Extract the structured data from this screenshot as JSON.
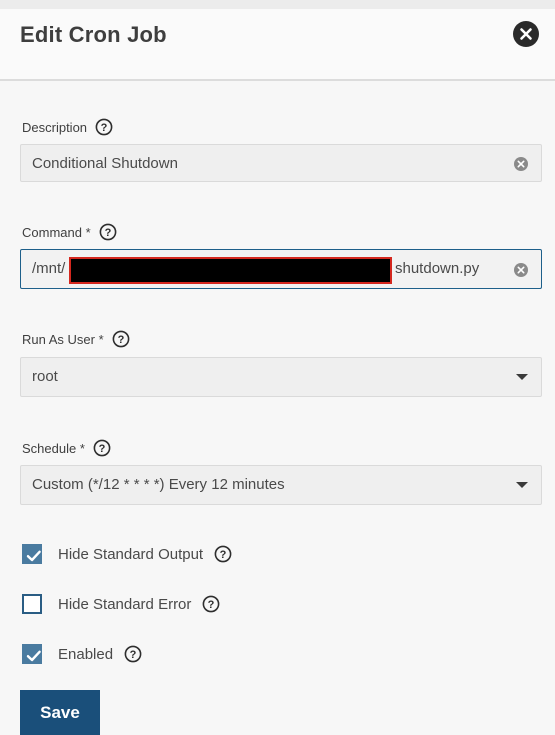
{
  "dialog": {
    "title": "Edit Cron Job"
  },
  "form": {
    "description": {
      "label": "Description",
      "value": "Conditional Shutdown"
    },
    "command": {
      "label": "Command *",
      "prefix": "/mnt/",
      "suffix": "shutdown.py",
      "redacted": true
    },
    "run_as_user": {
      "label": "Run As User *",
      "value": "root"
    },
    "schedule": {
      "label": "Schedule *",
      "value": "Custom (*/12 * * * *) Every 12 minutes"
    },
    "hide_stdout": {
      "label": "Hide Standard Output",
      "checked": true
    },
    "hide_stderr": {
      "label": "Hide Standard Error",
      "checked": false
    },
    "enabled": {
      "label": "Enabled",
      "checked": true
    }
  },
  "actions": {
    "save_label": "Save"
  },
  "colors": {
    "primary": "#1a4f7a",
    "checkbox": "#4a7ba0",
    "focus_border": "#1d5f8a",
    "redaction_border": "#d4271e"
  },
  "icons": {
    "close": "close-icon",
    "help": "help-icon",
    "clear": "clear-icon",
    "dropdown": "chevron-down-icon",
    "check": "checkmark-icon"
  }
}
